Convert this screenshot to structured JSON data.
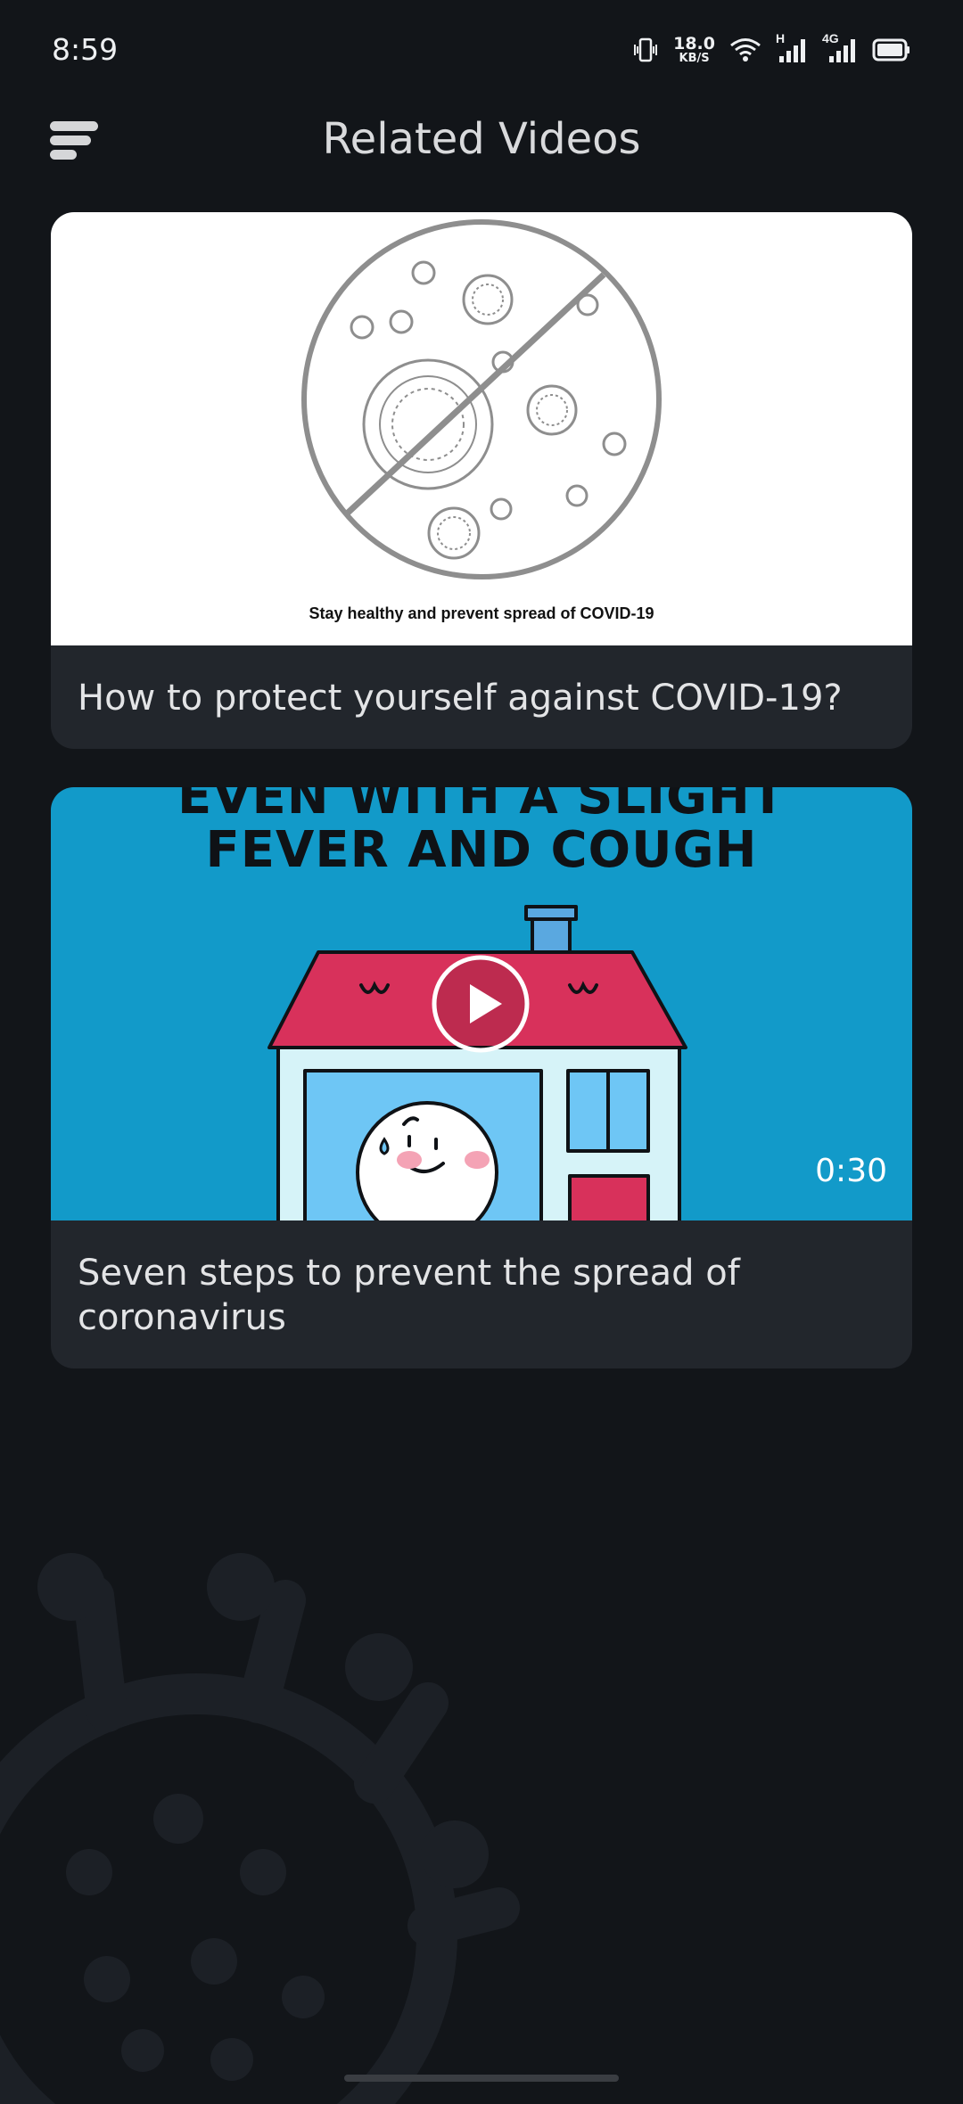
{
  "status_bar": {
    "time": "8:59",
    "net_speed_value": "18.0",
    "net_speed_unit": "KB/S",
    "net_type_1": "H",
    "net_type_2": "4G",
    "icons": [
      "vibrate-icon",
      "wifi-icon",
      "signal-icon",
      "signal-icon",
      "battery-icon"
    ]
  },
  "header": {
    "title": "Related Videos",
    "menu_icon": "menu-icon"
  },
  "videos": [
    {
      "title": "How to protect yourself against COVID-19?",
      "thumbnail_caption": "Stay healthy and prevent spread of COVID-19"
    },
    {
      "title": "Seven steps to prevent the spread of coronavirus",
      "thumbnail_text_line1": "EVEN WITH A SLIGHT",
      "thumbnail_text_line2": "FEVER AND COUGH",
      "duration": "0:30",
      "play_icon": "play-icon"
    }
  ],
  "colors": {
    "background": "#121519",
    "card": "#22262c",
    "thumbnail_blue": "#129ac9",
    "roof_red": "#d8315b"
  }
}
